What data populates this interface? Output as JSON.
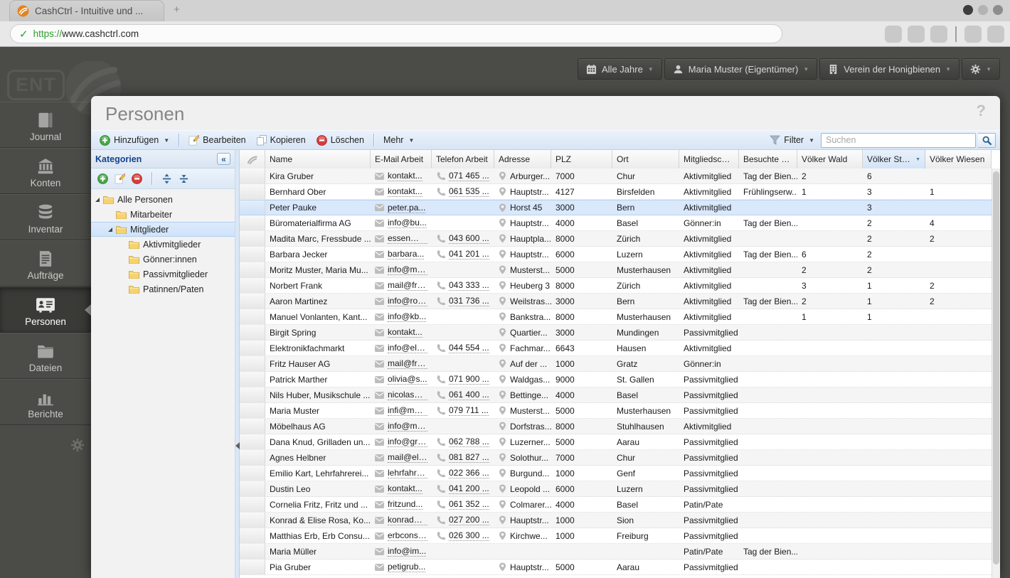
{
  "browser": {
    "tab_title": "CashCtrl - Intuitive und ...",
    "new_tab": "+",
    "url_scheme": "https://",
    "url_host": "www.cashctrl.com"
  },
  "topbar": {
    "year_button": "Alle Jahre",
    "user_button": "Maria Muster (Eigentümer)",
    "org_button": "Verein der Honigbienen"
  },
  "sidebar": {
    "logo_text": "ENT",
    "items": [
      {
        "id": "journal",
        "label": "Journal",
        "active": false
      },
      {
        "id": "konten",
        "label": "Konten",
        "active": false
      },
      {
        "id": "inventar",
        "label": "Inventar",
        "active": false
      },
      {
        "id": "auftraege",
        "label": "Aufträge",
        "active": false
      },
      {
        "id": "personen",
        "label": "Personen",
        "active": true
      },
      {
        "id": "dateien",
        "label": "Dateien",
        "active": false
      },
      {
        "id": "berichte",
        "label": "Berichte",
        "active": false
      }
    ]
  },
  "panel": {
    "title": "Personen",
    "help": "?"
  },
  "toolbar": {
    "add": "Hinzufügen",
    "edit": "Bearbeiten",
    "copy": "Kopieren",
    "delete": "Löschen",
    "more": "Mehr",
    "filter": "Filter",
    "search_placeholder": "Suchen"
  },
  "categories": {
    "title": "Kategorien",
    "collapse": "«",
    "tree": [
      {
        "label": "Alle Personen",
        "depth": 0,
        "caret": true,
        "selected": false
      },
      {
        "label": "Mitarbeiter",
        "depth": 1,
        "caret": false,
        "selected": false
      },
      {
        "label": "Mitglieder",
        "depth": 1,
        "caret": true,
        "selected": true
      },
      {
        "label": "Aktivmitglieder",
        "depth": 2,
        "caret": false,
        "selected": false
      },
      {
        "label": "Gönner:innen",
        "depth": 2,
        "caret": false,
        "selected": false
      },
      {
        "label": "Passivmitglieder",
        "depth": 2,
        "caret": false,
        "selected": false
      },
      {
        "label": "Patinnen/Paten",
        "depth": 2,
        "caret": false,
        "selected": false
      }
    ]
  },
  "grid": {
    "columns": [
      "Name",
      "E-Mail Arbeit",
      "Telefon Arbeit",
      "Adresse",
      "PLZ",
      "Ort",
      "Mitgliedschaft",
      "Besuchte Ku...",
      "Völker Wald",
      "Völker Stadt...",
      "Völker Wiesen"
    ],
    "sorted_column": "Völker Stadt...",
    "rows": [
      {
        "name": "Kira Gruber",
        "email": "kontakt...",
        "phone": "071 465 ...",
        "address": "Arburger...",
        "plz": "7000",
        "ort": "Chur",
        "mitgliedschaft": "Aktivmitglied",
        "kurse": "Tag der Bien...",
        "wald": "2",
        "stadt": "6",
        "wiesen": "",
        "selected": false
      },
      {
        "name": "Bernhard Ober",
        "email": "kontakt...",
        "phone": "061 535 ...",
        "address": "Hauptstr...",
        "plz": "4127",
        "ort": "Birsfelden",
        "mitgliedschaft": "Aktivmitglied",
        "kurse": "Frühlingserw...",
        "wald": "1",
        "stadt": "3",
        "wiesen": "1",
        "selected": false
      },
      {
        "name": "Peter Pauke",
        "email": "peter.pa...",
        "phone": "",
        "address": "Horst 45",
        "plz": "3000",
        "ort": "Bern",
        "mitgliedschaft": "Aktivmitglied",
        "kurse": "",
        "wald": "",
        "stadt": "3",
        "wiesen": "",
        "selected": true
      },
      {
        "name": "Büromaterialfirma AG",
        "email": "info@bu...",
        "phone": "",
        "address": "Hauptstr...",
        "plz": "4000",
        "ort": "Basel",
        "mitgliedschaft": "Gönner:in",
        "kurse": "Tag der Bien...",
        "wald": "",
        "stadt": "2",
        "wiesen": "4",
        "selected": false
      },
      {
        "name": "Madita Marc, Fressbude ...",
        "email": "essen@fr...",
        "phone": "043 600 ...",
        "address": "Hauptpla...",
        "plz": "8000",
        "ort": "Zürich",
        "mitgliedschaft": "Aktivmitglied",
        "kurse": "",
        "wald": "",
        "stadt": "2",
        "wiesen": "2",
        "selected": false
      },
      {
        "name": "Barbara Jecker",
        "email": "barbara...",
        "phone": "041 201 ...",
        "address": "Hauptstr...",
        "plz": "6000",
        "ort": "Luzern",
        "mitgliedschaft": "Aktivmitglied",
        "kurse": "Tag der Bien...",
        "wald": "6",
        "stadt": "2",
        "wiesen": "",
        "selected": false
      },
      {
        "name": "Moritz Muster, Maria Mu...",
        "email": "info@mu...",
        "phone": "",
        "address": "Musterst...",
        "plz": "5000",
        "ort": "Musterhausen",
        "mitgliedschaft": "Aktivmitglied",
        "kurse": "",
        "wald": "2",
        "stadt": "2",
        "wiesen": "",
        "selected": false
      },
      {
        "name": "Norbert Frank",
        "email": "mail@fra...",
        "phone": "043 333 ...",
        "address": "Heuberg 3",
        "plz": "8000",
        "ort": "Zürich",
        "mitgliedschaft": "Aktivmitglied",
        "kurse": "",
        "wald": "3",
        "stadt": "1",
        "wiesen": "2",
        "selected": false
      },
      {
        "name": "Aaron Martinez",
        "email": "info@roh...",
        "phone": "031 736 ...",
        "address": "Weilstras...",
        "plz": "3000",
        "ort": "Bern",
        "mitgliedschaft": "Aktivmitglied",
        "kurse": "Tag der Bien...",
        "wald": "2",
        "stadt": "1",
        "wiesen": "2",
        "selected": false
      },
      {
        "name": "Manuel Vonlanten, Kant...",
        "email": "info@kb...",
        "phone": "",
        "address": "Bankstra...",
        "plz": "8000",
        "ort": "Musterhausen",
        "mitgliedschaft": "Aktivmitglied",
        "kurse": "",
        "wald": "1",
        "stadt": "1",
        "wiesen": "",
        "selected": false
      },
      {
        "name": "Birgit Spring",
        "email": "kontakt...",
        "phone": "",
        "address": "Quartier...",
        "plz": "3000",
        "ort": "Mundingen",
        "mitgliedschaft": "Passivmitglied",
        "kurse": "",
        "wald": "",
        "stadt": "",
        "wiesen": "",
        "selected": false
      },
      {
        "name": "Elektronikfachmarkt",
        "email": "info@ele...",
        "phone": "044 554 ...",
        "address": "Fachmar...",
        "plz": "6643",
        "ort": "Hausen",
        "mitgliedschaft": "Aktivmitglied",
        "kurse": "",
        "wald": "",
        "stadt": "",
        "wiesen": "",
        "selected": false
      },
      {
        "name": "Fritz Hauser AG",
        "email": "mail@frit...",
        "phone": "",
        "address": "Auf der ...",
        "plz": "1000",
        "ort": "Gratz",
        "mitgliedschaft": "Gönner:in",
        "kurse": "",
        "wald": "",
        "stadt": "",
        "wiesen": "",
        "selected": false
      },
      {
        "name": "Patrick Marther",
        "email": "olivia@s...",
        "phone": "071 900 ...",
        "address": "Waldgas...",
        "plz": "9000",
        "ort": "St. Gallen",
        "mitgliedschaft": "Passivmitglied",
        "kurse": "",
        "wald": "",
        "stadt": "",
        "wiesen": "",
        "selected": false
      },
      {
        "name": "Nils Huber, Musikschule ...",
        "email": "nicolas@...",
        "phone": "061 400 ...",
        "address": "Bettinge...",
        "plz": "4000",
        "ort": "Basel",
        "mitgliedschaft": "Passivmitglied",
        "kurse": "",
        "wald": "",
        "stadt": "",
        "wiesen": "",
        "selected": false
      },
      {
        "name": "Maria Muster",
        "email": "infi@mus...",
        "phone": "079 711 ...",
        "address": "Musterst...",
        "plz": "5000",
        "ort": "Musterhausen",
        "mitgliedschaft": "Passivmitglied",
        "kurse": "",
        "wald": "",
        "stadt": "",
        "wiesen": "",
        "selected": false
      },
      {
        "name": "Möbelhaus AG",
        "email": "info@mo...",
        "phone": "",
        "address": "Dorfstras...",
        "plz": "8000",
        "ort": "Stuhlhausen",
        "mitgliedschaft": "Aktivmitglied",
        "kurse": "",
        "wald": "",
        "stadt": "",
        "wiesen": "",
        "selected": false
      },
      {
        "name": "Dana Knud, Grilladen un...",
        "email": "info@gril...",
        "phone": "062 788 ...",
        "address": "Luzerner...",
        "plz": "5000",
        "ort": "Aarau",
        "mitgliedschaft": "Passivmitglied",
        "kurse": "",
        "wald": "",
        "stadt": "",
        "wiesen": "",
        "selected": false
      },
      {
        "name": "Agnes Helbner",
        "email": "mail@ele...",
        "phone": "081 827 ...",
        "address": "Solothur...",
        "plz": "7000",
        "ort": "Chur",
        "mitgliedschaft": "Passivmitglied",
        "kurse": "",
        "wald": "",
        "stadt": "",
        "wiesen": "",
        "selected": false
      },
      {
        "name": "Emilio Kart, Lehrfahrerei...",
        "email": "lehrfahre...",
        "phone": "022 366 ...",
        "address": "Burgund...",
        "plz": "1000",
        "ort": "Genf",
        "mitgliedschaft": "Passivmitglied",
        "kurse": "",
        "wald": "",
        "stadt": "",
        "wiesen": "",
        "selected": false
      },
      {
        "name": "Dustin Leo",
        "email": "kontakt...",
        "phone": "041 200 ...",
        "address": "Leopold ...",
        "plz": "6000",
        "ort": "Luzern",
        "mitgliedschaft": "Passivmitglied",
        "kurse": "",
        "wald": "",
        "stadt": "",
        "wiesen": "",
        "selected": false
      },
      {
        "name": "Cornelia Fritz, Fritz und ...",
        "email": "fritzund...",
        "phone": "061 352 ...",
        "address": "Colmarer...",
        "plz": "4000",
        "ort": "Basel",
        "mitgliedschaft": "Patin/Pate",
        "kurse": "",
        "wald": "",
        "stadt": "",
        "wiesen": "",
        "selected": false
      },
      {
        "name": "Konrad & Elise Rosa, Ko...",
        "email": "konrad@...",
        "phone": "027 200 ...",
        "address": "Hauptstr...",
        "plz": "1000",
        "ort": "Sion",
        "mitgliedschaft": "Passivmitglied",
        "kurse": "",
        "wald": "",
        "stadt": "",
        "wiesen": "",
        "selected": false
      },
      {
        "name": "Matthias Erb, Erb Consu...",
        "email": "erbconsu...",
        "phone": "026 300 ...",
        "address": "Kirchwe...",
        "plz": "1000",
        "ort": "Freiburg",
        "mitgliedschaft": "Passivmitglied",
        "kurse": "",
        "wald": "",
        "stadt": "",
        "wiesen": "",
        "selected": false
      },
      {
        "name": "Maria Müller",
        "email": "info@im...",
        "phone": "",
        "address": "",
        "plz": "",
        "ort": "",
        "mitgliedschaft": "Patin/Pate",
        "kurse": "Tag der Bien...",
        "wald": "",
        "stadt": "",
        "wiesen": "",
        "selected": false
      },
      {
        "name": "Pia Gruber",
        "email": "petigrub...",
        "phone": "",
        "address": "Hauptstr...",
        "plz": "5000",
        "ort": "Aarau",
        "mitgliedschaft": "Passivmitglied",
        "kurse": "",
        "wald": "",
        "stadt": "",
        "wiesen": "",
        "selected": false
      }
    ]
  }
}
